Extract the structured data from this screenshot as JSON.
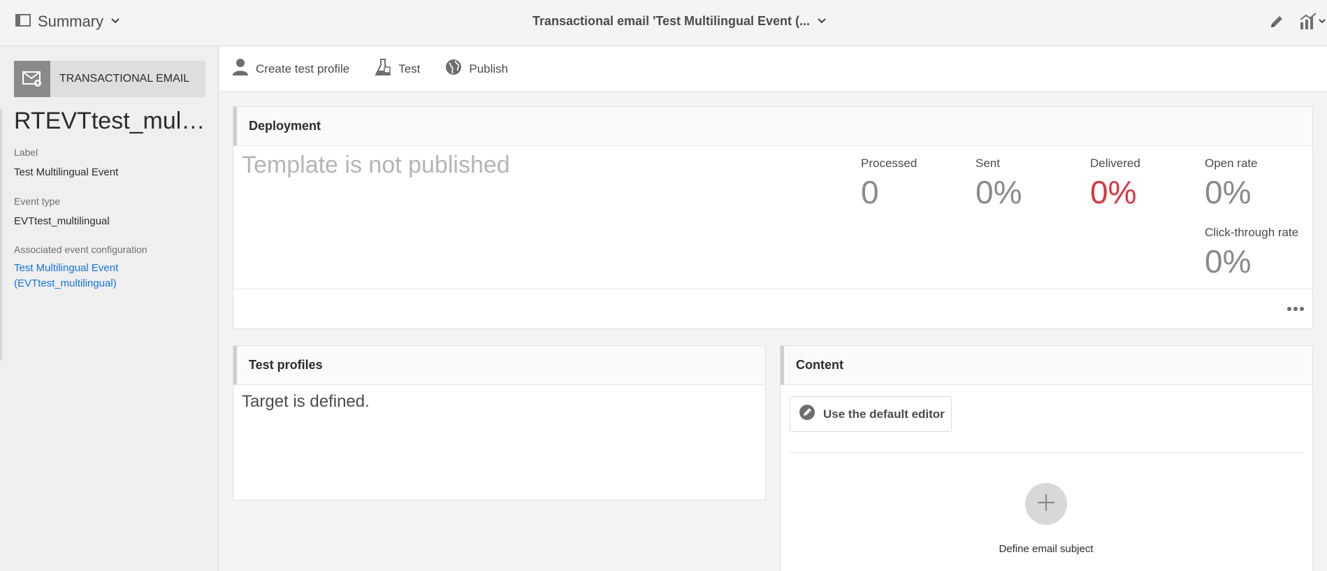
{
  "topbar": {
    "summary_label": "Summary",
    "title": "Transactional email 'Test Multilingual Event (...",
    "icons": [
      "sidebar-toggle-icon",
      "chevron-down-icon",
      "pencil-icon",
      "report-chart-icon"
    ]
  },
  "sidebar": {
    "type_label": "TRANSACTIONAL EMAIL",
    "record_name": "RTEVTtest_multilingual",
    "label_key": "Label",
    "label_value": "Test Multilingual Event",
    "event_type_key": "Event type",
    "event_type_value": "EVTtest_multilingual",
    "assoc_key": "Associated event configuration",
    "assoc_line1": "Test Multilingual Event",
    "assoc_line2": "(EVTtest_multilingual)"
  },
  "actions": {
    "create_test_profile": "Create test profile",
    "test": "Test",
    "publish": "Publish"
  },
  "deployment": {
    "title": "Deployment",
    "status": "Template is not published",
    "metrics": {
      "processed_label": "Processed",
      "processed_value": "0",
      "sent_label": "Sent",
      "sent_value": "0%",
      "delivered_label": "Delivered",
      "delivered_value": "0%",
      "open_rate_label": "Open rate",
      "open_rate_value": "0%",
      "ctr_label": "Click-through rate",
      "ctr_value": "0%"
    }
  },
  "test_profiles": {
    "title": "Test profiles",
    "body": "Target is defined."
  },
  "content": {
    "title": "Content",
    "editor_button": "Use the default editor",
    "define_subject": "Define email subject"
  },
  "colors": {
    "accent_link": "#1473e6",
    "delivered_red": "#d7373f"
  }
}
